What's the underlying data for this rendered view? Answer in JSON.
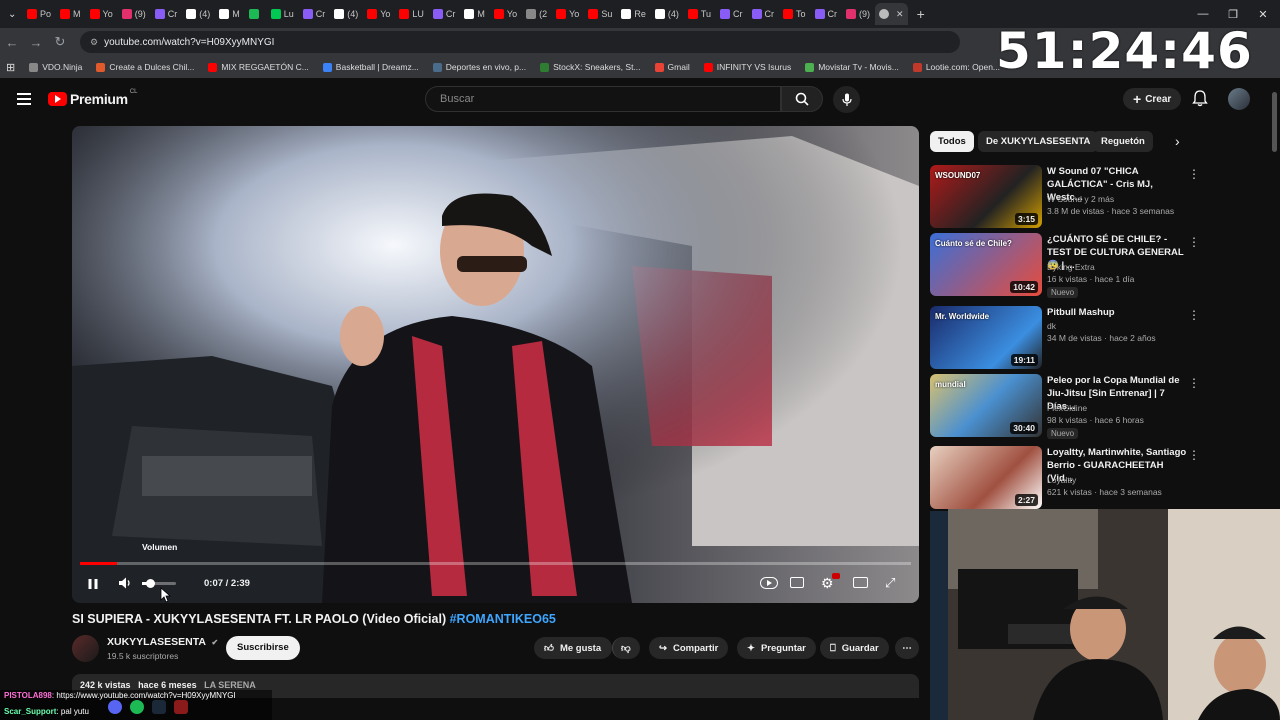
{
  "browser": {
    "tabs": [
      "Po",
      "M",
      "Yo",
      "(9)",
      "Cr",
      "(4)",
      "M",
      "",
      "Lu",
      "Cr",
      "(4)",
      "Yo",
      "LU",
      "Cr",
      "M",
      "Yo",
      "(2",
      "Yo",
      "Su",
      "Re",
      "(4)",
      "Tu",
      "Cr",
      "Cr",
      "To",
      "Cr",
      "(9)"
    ],
    "url": "youtube.com/watch?v=H09XyyMNYGI",
    "bookmarks": [
      "VDO.Ninja",
      "Create a Dulces Chil...",
      "MIX REGGAETÓN C...",
      "Basketball | Dreamz...",
      "Deportes en vivo, p...",
      "StockX: Sneakers, St...",
      "Gmail",
      "INFINITY VS Isurus",
      "Movistar Tv - Movis...",
      "Lootie.com: Open..."
    ]
  },
  "timer": "51:24:46",
  "youtube": {
    "logo": "Premium",
    "region": "CL",
    "search_placeholder": "Buscar",
    "create_label": "Crear"
  },
  "player": {
    "tooltip": "Volumen",
    "time": "0:07 / 2:39",
    "progress_fraction": 0.0441
  },
  "video_info": {
    "title": "SI SUPIERA - XUKYYLASESENTA FT. LR PAOLO (Video Oficial)",
    "hashtag": "#ROMANTIKEO65",
    "channel": "XUKYYLASESENTA",
    "subs": "19.5 k suscriptores",
    "subscribe": "Suscribirse",
    "like": "Me gusta",
    "share": "Compartir",
    "ask": "Preguntar",
    "save": "Guardar",
    "views": "242 k vistas",
    "age": "hace 6 meses",
    "location": "LA SERENA"
  },
  "chips": [
    "Todos",
    "De XUKYYLASESENTA",
    "Reguetón"
  ],
  "recommendations": [
    {
      "title": "W Sound 07 \"CHICA GALÁCTICA\" - Cris MJ, Westc...",
      "channel": "W Sound",
      "extra": "y 2 más",
      "meta": "3.8 M de vistas · hace 3 semanas",
      "duration": "3:15",
      "badge": "",
      "thumb_text": "WSOUND07"
    },
    {
      "title": "¿CUÁNTO SÉ DE CHILE? - TEST DE CULTURA GENERAL 😨 | ...",
      "channel": "Byking Extra",
      "extra": "",
      "meta": "16 k vistas · hace 1 día",
      "duration": "10:42",
      "badge": "Nuevo",
      "thumb_text": "Cuánto sé de Chile?"
    },
    {
      "title": "Pitbull Mashup",
      "channel": "dk",
      "extra": "",
      "meta": "34 M de vistas · hace 2 años",
      "duration": "19:11",
      "badge": "",
      "thumb_text": "Mr. Worldwide"
    },
    {
      "title": "Peleo por la Copa Mundial de Jiu-Jitsu [Sin Entrenar] | 7 Días...",
      "channel": "FlexCldine",
      "extra": "",
      "meta": "98 k vistas · hace 6 horas",
      "duration": "30:40",
      "badge": "Nuevo",
      "thumb_text": "mundial"
    },
    {
      "title": "Loyaltty, Martinwhite, Santiago Berrio - GUARACHEETAH (Vid...",
      "channel": "Loyaltty",
      "extra": "",
      "meta": "621 k vistas · hace 3 semanas",
      "duration": "2:27",
      "badge": "",
      "thumb_text": ""
    }
  ],
  "chat": {
    "line1_user": "PISTOLA898",
    "line1_text": ": https://www.youtube.com/watch?v=H09XyyMNYGI",
    "line2_user": "Scar_Support",
    "line2_text": ": pal yutu"
  },
  "colors": {
    "accent": "#ff0000",
    "link": "#3ea6ff",
    "bg": "#0f0f0f"
  }
}
